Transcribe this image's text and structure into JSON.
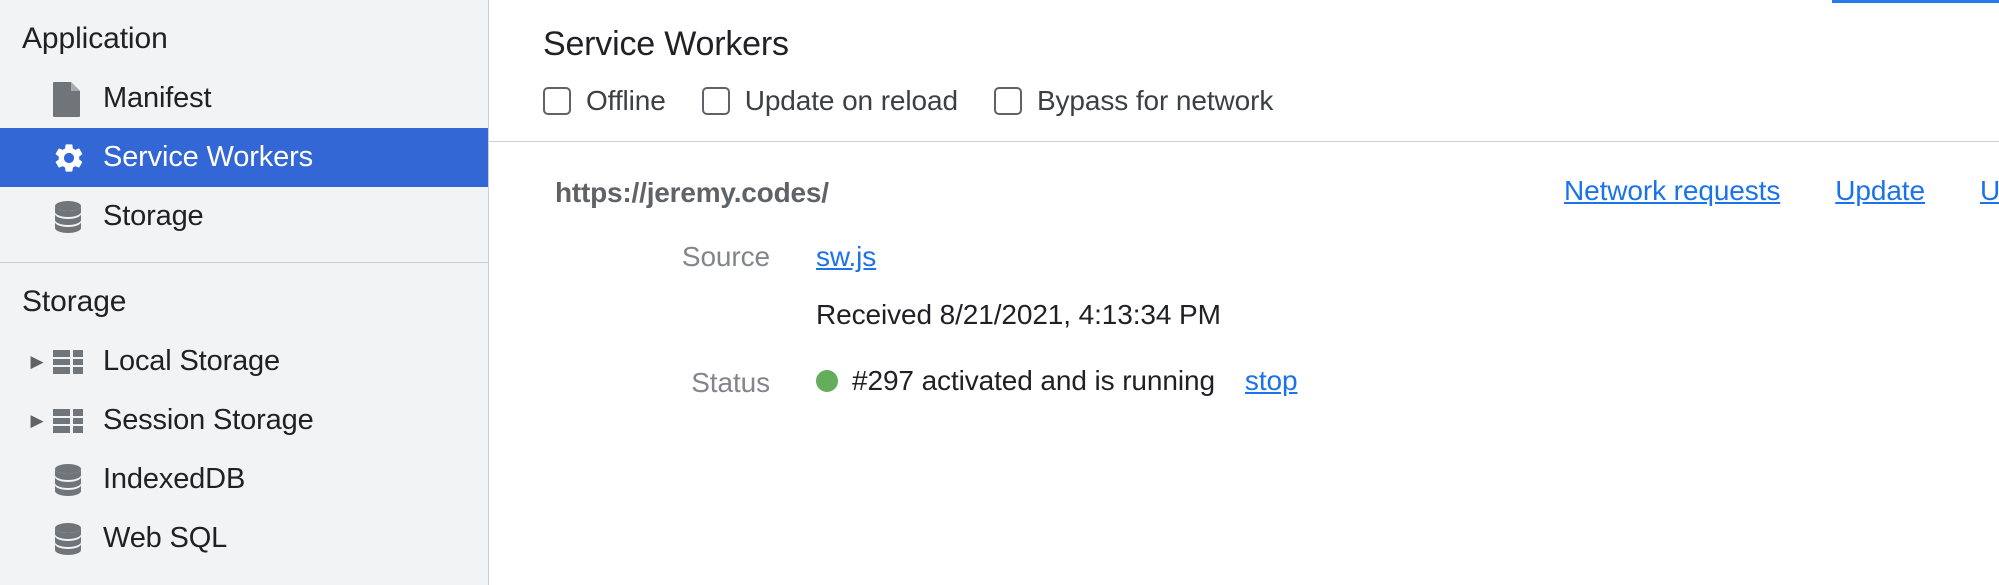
{
  "sidebar": {
    "sections": [
      {
        "title": "Application",
        "items": [
          {
            "label": "Manifest",
            "icon": "document-icon",
            "selected": false,
            "expandable": false
          },
          {
            "label": "Service Workers",
            "icon": "gear-icon",
            "selected": true,
            "expandable": false
          },
          {
            "label": "Storage",
            "icon": "database-icon",
            "selected": false,
            "expandable": false
          }
        ]
      },
      {
        "title": "Storage",
        "items": [
          {
            "label": "Local Storage",
            "icon": "table-icon",
            "selected": false,
            "expandable": true
          },
          {
            "label": "Session Storage",
            "icon": "table-icon",
            "selected": false,
            "expandable": true
          },
          {
            "label": "IndexedDB",
            "icon": "database-icon",
            "selected": false,
            "expandable": false
          },
          {
            "label": "Web SQL",
            "icon": "database-icon",
            "selected": false,
            "expandable": false
          }
        ]
      }
    ],
    "twisty_glyph": "▶"
  },
  "main": {
    "title": "Service Workers",
    "options": [
      {
        "label": "Offline",
        "checked": false
      },
      {
        "label": "Update on reload",
        "checked": false
      },
      {
        "label": "Bypass for network",
        "checked": false
      }
    ],
    "registration": {
      "scope_url": "https://jeremy.codes/",
      "actions": [
        {
          "label": "Network requests"
        },
        {
          "label": "Update"
        },
        {
          "label": "Unregister"
        }
      ],
      "source_label": "Source",
      "source_file": "sw.js",
      "received_text": "Received 8/21/2021, 4:13:34 PM",
      "status_label": "Status",
      "status_text": "#297 activated and is running",
      "status_stop_label": "stop",
      "status_color": "#63ad5c"
    }
  },
  "colors": {
    "selection_blue": "#3367d6",
    "link_blue": "#1a73e8",
    "sidebar_bg": "#f1f3f4",
    "border": "#cdd0d3",
    "muted_text": "#80868b"
  }
}
